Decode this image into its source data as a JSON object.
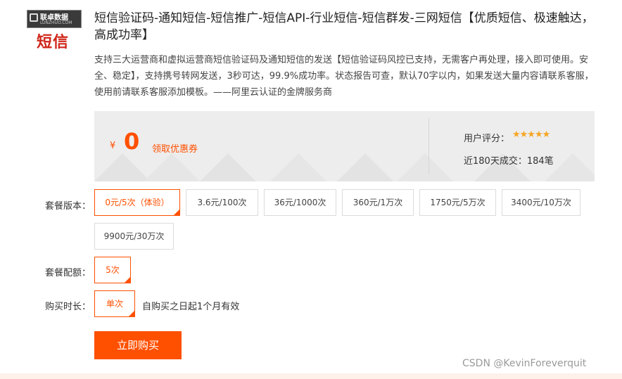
{
  "logo": {
    "top_text": "联卓数据",
    "sub_text": "LUNZHUO.COM",
    "main_text": "短信"
  },
  "product": {
    "title": "短信验证码-通知短信-短信推广-短信API-行业短信-短信群发-三网短信【优质短信、极速触达，高成功率】",
    "description": "支持三大运营商和虚拟运营商短信验证码及通知短信的发送【短信验证码风控已支持，无需客户再处理，接入即可使用。安全、稳定】，支持携号转网发送，3秒可达，99.9%成功率。状态报告可查，默认70字以内，如果发送大量内容请联系客服，使用前请联系客服添加模板。——阿里云认证的金牌服务商"
  },
  "price_panel": {
    "currency": "¥",
    "price": "0",
    "coupon_label": "领取优惠券",
    "rating_label": "用户评分：",
    "rating_stars": "★★★★★",
    "rating_value": 5,
    "sales_text": "近180天成交：184笔"
  },
  "package_version": {
    "label": "套餐版本：",
    "options": [
      "0元/5次（体验）",
      "3.6元/100次",
      "36元/1000次",
      "360元/1万次",
      "1750元/5万次",
      "3400元/10万次",
      "9900元/30万次"
    ],
    "selected": "0元/5次（体验）"
  },
  "package_quota": {
    "label": "套餐配额：",
    "options": [
      "5次"
    ],
    "selected": "5次"
  },
  "purchase_duration": {
    "label": "购买时长：",
    "options": [
      "单次"
    ],
    "selected": "单次",
    "note": "自购买之日起1个月有效"
  },
  "buy_button_label": "立即购买",
  "watermark": "CSDN @KevinForeverquit",
  "colors": {
    "accent": "#ff5000",
    "star": "#f5a623",
    "panel_bg": "#ededed",
    "logo_red": "#d0261a"
  }
}
